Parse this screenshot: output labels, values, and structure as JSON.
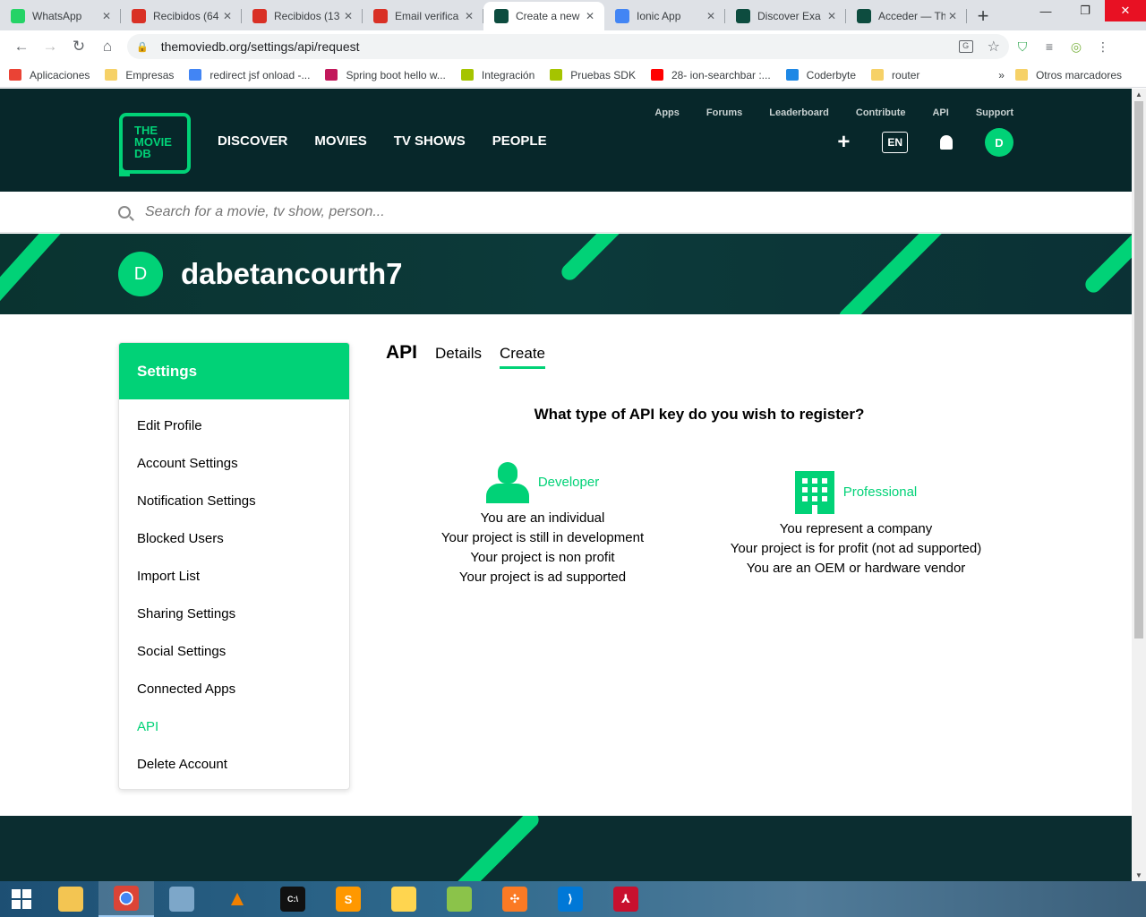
{
  "browser": {
    "tabs": [
      {
        "title": "WhatsApp",
        "icon": "whatsapp-icon",
        "color": "#25d366",
        "active": false
      },
      {
        "title": "Recibidos (64",
        "icon": "gmail-icon",
        "color": "#d93025",
        "active": false
      },
      {
        "title": "Recibidos (13",
        "icon": "gmail-icon",
        "color": "#d93025",
        "active": false
      },
      {
        "title": "Email verifica",
        "icon": "gmail-icon",
        "color": "#d93025",
        "active": false
      },
      {
        "title": "Create a new",
        "icon": "tmdb-icon",
        "color": "#0d4c3f",
        "active": true
      },
      {
        "title": "Ionic App",
        "icon": "ionic-icon",
        "color": "#4285f4",
        "active": false
      },
      {
        "title": "Discover Exa",
        "icon": "tmdb-icon",
        "color": "#0d4c3f",
        "active": false
      },
      {
        "title": "Acceder — Th",
        "icon": "tmdb-icon",
        "color": "#0d4c3f",
        "active": false
      }
    ],
    "close_glyph": "✕",
    "new_tab_glyph": "+",
    "url": "themoviedb.org/settings/api/request",
    "bookmarks": [
      {
        "label": "Aplicaciones",
        "icon": "apps-grid-icon",
        "color": "#ea4335"
      },
      {
        "label": "Empresas",
        "icon": "folder-icon",
        "color": "#f6d167"
      },
      {
        "label": "redirect jsf onload -...",
        "icon": "google-icon",
        "color": "#4285f4"
      },
      {
        "label": "Spring boot hello w...",
        "icon": "spring-icon",
        "color": "#c2185b"
      },
      {
        "label": "Integración",
        "icon": "udemy-icon",
        "color": "#a5c400"
      },
      {
        "label": "Pruebas SDK",
        "icon": "udemy-icon",
        "color": "#a5c400"
      },
      {
        "label": "28- ion-searchbar :...",
        "icon": "youtube-icon",
        "color": "#ff0000"
      },
      {
        "label": "Coderbyte",
        "icon": "coderbyte-icon",
        "color": "#1e88e5"
      },
      {
        "label": "router",
        "icon": "folder-icon",
        "color": "#f6d167"
      }
    ],
    "bookmarks_more": "»",
    "other_bookmarks": "Otros marcadores"
  },
  "site": {
    "logo_lines": [
      "THE",
      "MOVIE",
      "DB"
    ],
    "main_nav": [
      "DISCOVER",
      "MOVIES",
      "TV SHOWS",
      "PEOPLE"
    ],
    "sub_nav": [
      "Apps",
      "Forums",
      "Leaderboard",
      "Contribute",
      "API",
      "Support"
    ],
    "lang": "EN",
    "avatar_letter": "D",
    "search_placeholder": "Search for a movie, tv show, person..."
  },
  "profile": {
    "avatar_letter": "D",
    "username": "dabetancourth7"
  },
  "settings": {
    "title": "Settings",
    "items": [
      {
        "label": "Edit Profile",
        "active": false
      },
      {
        "label": "Account Settings",
        "active": false
      },
      {
        "label": "Notification Settings",
        "active": false
      },
      {
        "label": "Blocked Users",
        "active": false
      },
      {
        "label": "Import List",
        "active": false
      },
      {
        "label": "Sharing Settings",
        "active": false
      },
      {
        "label": "Social Settings",
        "active": false
      },
      {
        "label": "Connected Apps",
        "active": false
      },
      {
        "label": "API",
        "active": true
      },
      {
        "label": "Delete Account",
        "active": false
      }
    ]
  },
  "api": {
    "title": "API",
    "tabs": [
      {
        "label": "Details",
        "active": false
      },
      {
        "label": "Create",
        "active": true
      }
    ],
    "question": "What type of API key do you wish to register?",
    "developer": {
      "label": "Developer",
      "lines": [
        "You are an individual",
        "Your project is still in development",
        "Your project is non profit",
        "Your project is ad supported"
      ]
    },
    "professional": {
      "label": "Professional",
      "lines": [
        "You represent a company",
        "Your project is for profit (not ad supported)",
        "You are an OEM or hardware vendor"
      ]
    }
  },
  "colors": {
    "accent": "#01d277",
    "header_bg": "#07272a"
  }
}
